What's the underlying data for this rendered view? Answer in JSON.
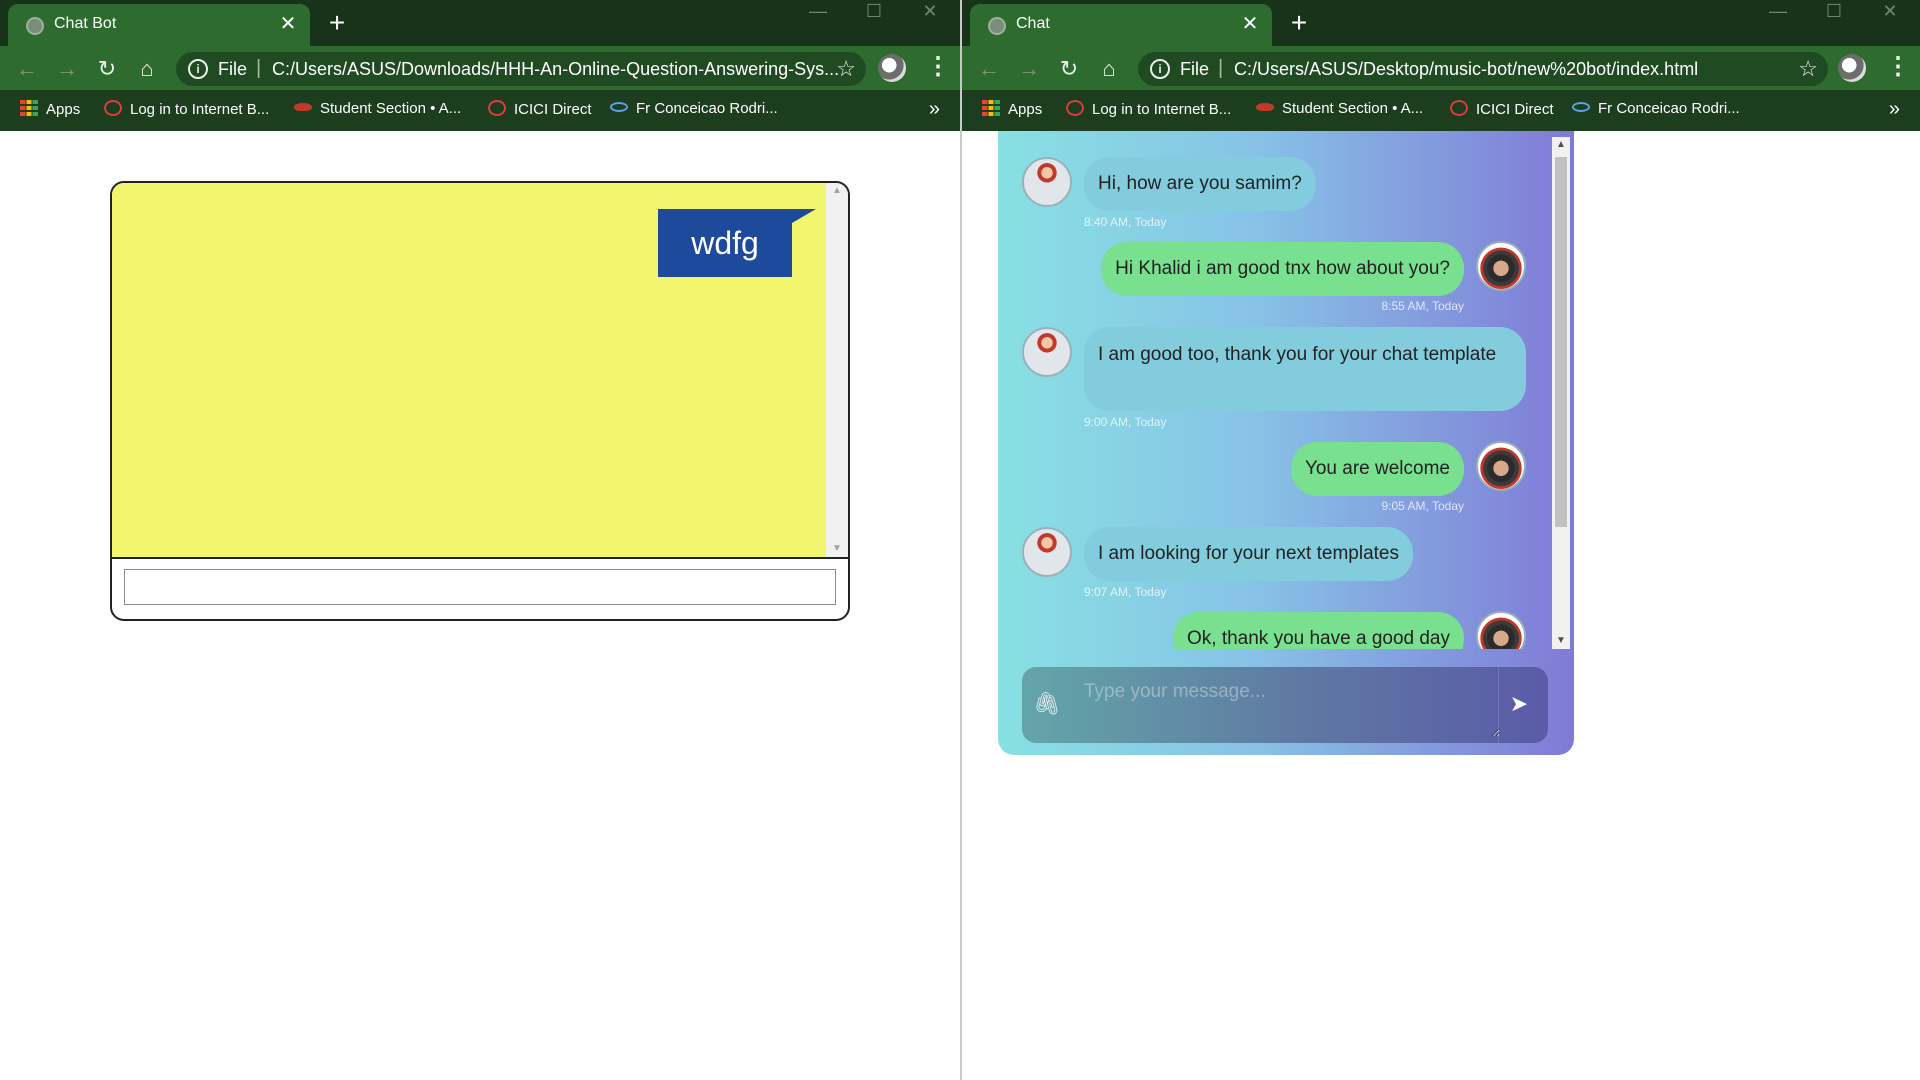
{
  "left_window": {
    "tab_title": "Chat Bot",
    "url_scheme": "File",
    "url": "C:/Users/ASUS/Downloads/HHH-An-Online-Question-Answering-Sys...",
    "bookmarks": [
      "Apps",
      "Log in to Internet B...",
      "Student Section • A...",
      "ICICI Direct",
      "Fr Conceicao Rodri..."
    ],
    "page": {
      "user_message": "wdfg",
      "input_value": "",
      "chat_bg_color": "#f2f56e",
      "user_bubble_color": "#1e4a9c"
    }
  },
  "right_window": {
    "tab_title": "Chat",
    "url_scheme": "File",
    "url": "C:/Users/ASUS/Desktop/music-bot/new%20bot/index.html",
    "bookmarks": [
      "Apps",
      "Log in to Internet B...",
      "Student Section • A...",
      "ICICI Direct",
      "Fr Conceicao Rodri..."
    ],
    "page": {
      "messages": [
        {
          "from": "bot",
          "text": "Hi, how are you samim?",
          "time": "8:40 AM, Today"
        },
        {
          "from": "user",
          "text": "Hi Khalid i am good tnx how about you?",
          "time": "8:55 AM, Today"
        },
        {
          "from": "bot",
          "text": "I am good too, thank you for your chat template",
          "time": "9:00 AM, Today"
        },
        {
          "from": "user",
          "text": "You are welcome",
          "time": "9:05 AM, Today"
        },
        {
          "from": "bot",
          "text": "I am looking for your next templates",
          "time": "9:07 AM, Today"
        },
        {
          "from": "user",
          "text": "Ok, thank you have a good day",
          "time": ""
        }
      ],
      "composer_placeholder": "Type your message...",
      "bot_bubble_color": "#82ccdd",
      "user_bubble_color": "#78e08f"
    }
  },
  "colors": {
    "chrome_dark": "#1d3d1f",
    "chrome_tab": "#2e6b2e"
  }
}
